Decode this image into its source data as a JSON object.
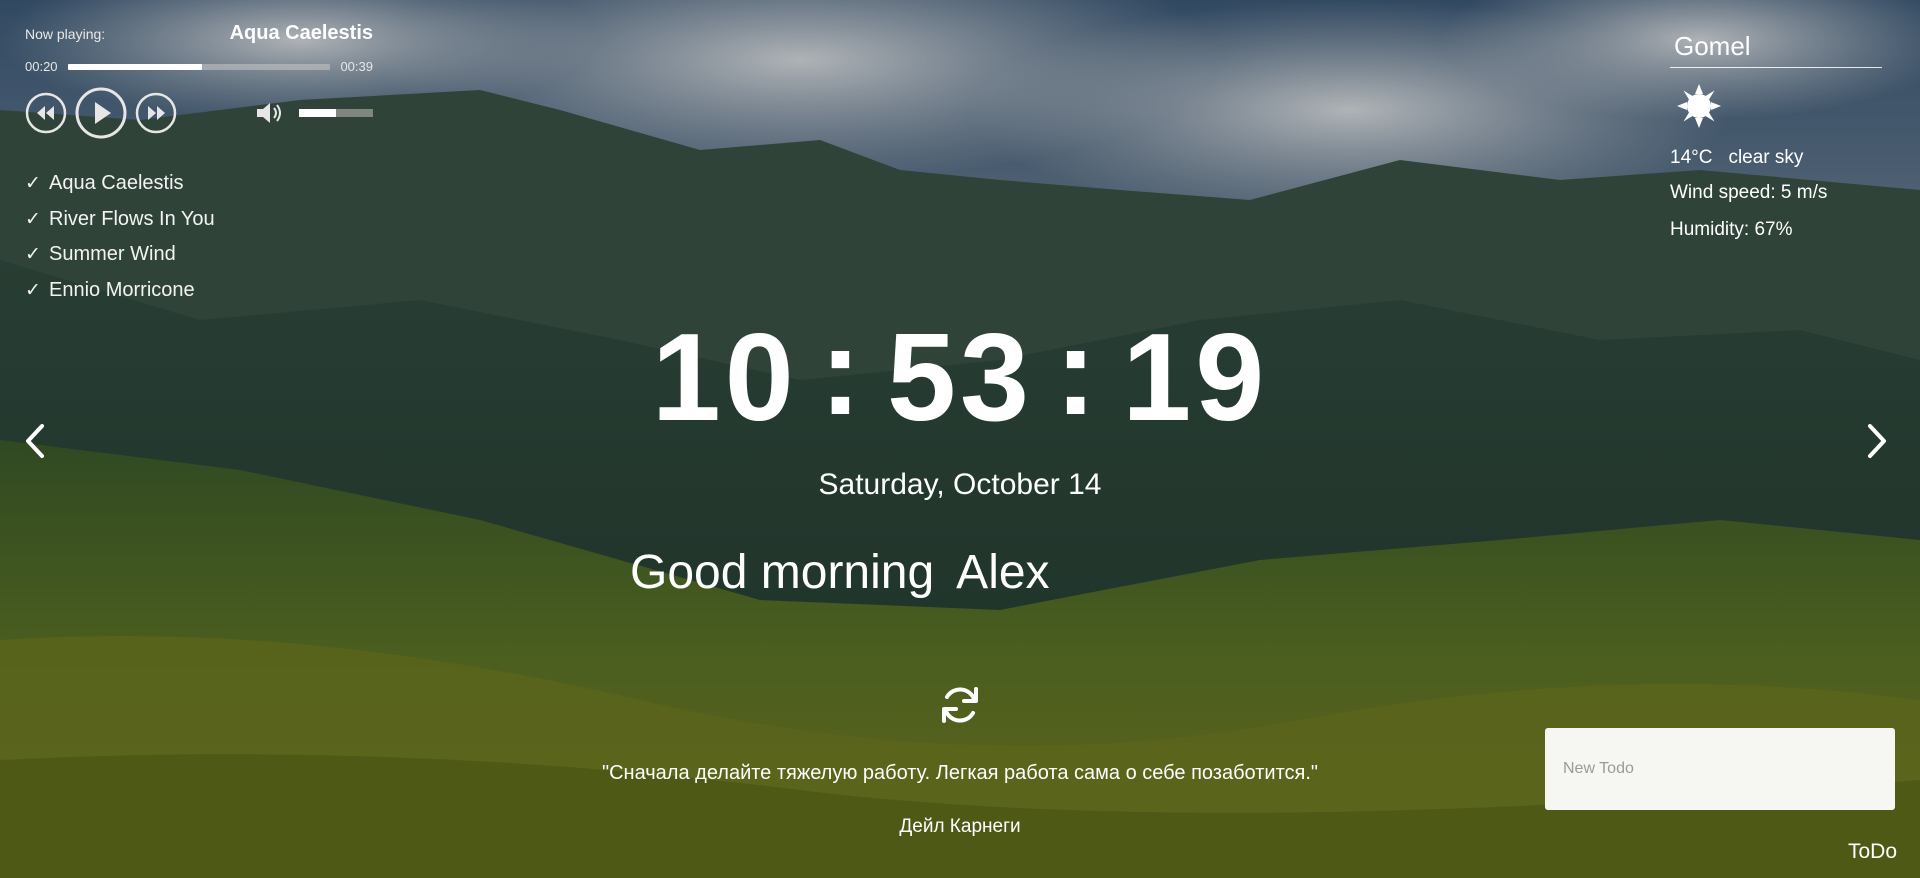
{
  "player": {
    "now_playing_label": "Now playing:",
    "current_title": "Aqua Caelestis",
    "time_current": "00:20",
    "time_total": "00:39",
    "progress_fraction": 0.51,
    "volume_fraction": 0.5,
    "icons": {
      "prev": "rewind-icon",
      "play": "play-icon",
      "next": "fast-forward-icon",
      "volume": "volume-icon"
    },
    "playlist": [
      {
        "check": "✓",
        "title": "Aqua Caelestis"
      },
      {
        "check": "✓",
        "title": "River Flows In You"
      },
      {
        "check": "✓",
        "title": "Summer Wind"
      },
      {
        "check": "✓",
        "title": "Ennio Morricone"
      }
    ]
  },
  "weather": {
    "city": "Gomel",
    "icon": "sun-icon",
    "temperature": "14°C",
    "description": "clear sky",
    "wind": "Wind speed: 5 m/s",
    "humidity": "Humidity: 67%"
  },
  "clock": {
    "hours": "10",
    "minutes": "53",
    "seconds": "19",
    "separator": ":"
  },
  "date": "Saturday, October 14",
  "greeting": {
    "text": "Good morning",
    "name": "Alex"
  },
  "quote": {
    "text": "\"Сначала делайте тяжелую работу. Легкая работа сама о себе позаботится.\"",
    "author": "Дейл Карнеги",
    "refresh_icon": "refresh-icon"
  },
  "navigation": {
    "prev_icon": "chevron-left-icon",
    "next_icon": "chevron-right-icon"
  },
  "todo": {
    "placeholder": "New Todo",
    "toggle_label": "ToDo"
  },
  "colors": {
    "text": "#ffffff",
    "progress_track": "#c8c8c8",
    "todo_background": "#ffffff"
  }
}
